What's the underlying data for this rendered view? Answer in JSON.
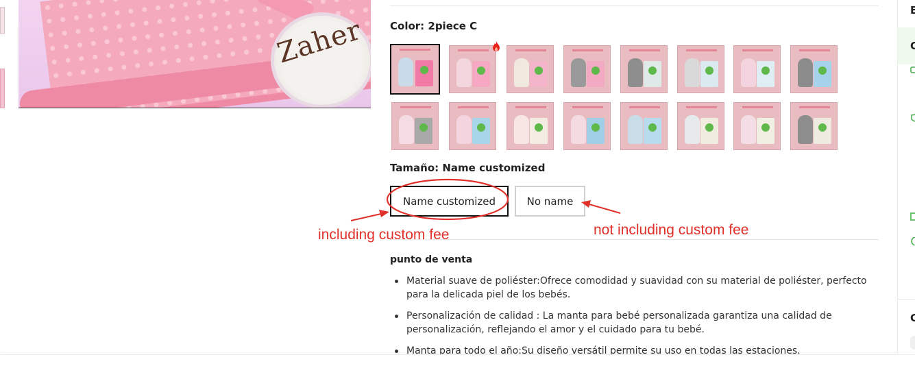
{
  "gallery": {
    "main_image_text": "Zaher",
    "thumbnails": [
      "thumb-1",
      "thumb-2"
    ]
  },
  "color": {
    "label": "Color: 2piece C",
    "selected_index": 0,
    "hot_badge_index": 1,
    "swatches": [
      {
        "toy": "#c9dbe8",
        "pack": "#f07aa5"
      },
      {
        "toy": "#f3d6de",
        "pack": "#f6a8c3"
      },
      {
        "toy": "#efe9e0",
        "pack": "#f3b3c8"
      },
      {
        "toy": "#9a9a9a",
        "pack": "#f4a9c2"
      },
      {
        "toy": "#8e8e8e",
        "pack": "#dfeae8"
      },
      {
        "toy": "#d9d9d9",
        "pack": "#dbeaf1"
      },
      {
        "toy": "#f3d3dd",
        "pack": "#dfeef5"
      },
      {
        "toy": "#8c8c8c",
        "pack": "#a6d2ea"
      },
      {
        "toy": "#f5dbe4",
        "pack": "#a9a9a9"
      },
      {
        "toy": "#f4d5df",
        "pack": "#a8d4ea"
      },
      {
        "toy": "#f7e6e3",
        "pack": "#f3ece2"
      },
      {
        "toy": "#f4dbe2",
        "pack": "#9fd0e6"
      },
      {
        "toy": "#c9dde9",
        "pack": "#b7dcee"
      },
      {
        "toy": "#e6eaed",
        "pack": "#f1ece0"
      },
      {
        "toy": "#f3dee5",
        "pack": "#f1eee4"
      },
      {
        "toy": "#8d8d8d",
        "pack": "#f0ebe0"
      }
    ]
  },
  "size": {
    "label": "Tamaño: Name customized",
    "options": [
      "Name customized",
      "No name"
    ],
    "selected_index": 0
  },
  "annotations": {
    "left_note": "including custom fee",
    "right_note": "not including custom fee",
    "color": "#e0302a"
  },
  "features": {
    "title": "punto de venta",
    "items": [
      "Material suave de poliéster:Ofrece comodidad y suavidad con su material de poliéster, perfecto para la delicada piel de los bebés.",
      "Personalización de calidad : La manta para bebé personalizada garantiza una calidad de personalización, reflejando el amor y el cuidado para tu bebé.",
      "Manta para todo el año:Su diseño versátil permite su uso en todas las estaciones."
    ]
  },
  "right_panel": {
    "letters": [
      "E",
      "C",
      "C"
    ],
    "accent": "#4caf50"
  }
}
